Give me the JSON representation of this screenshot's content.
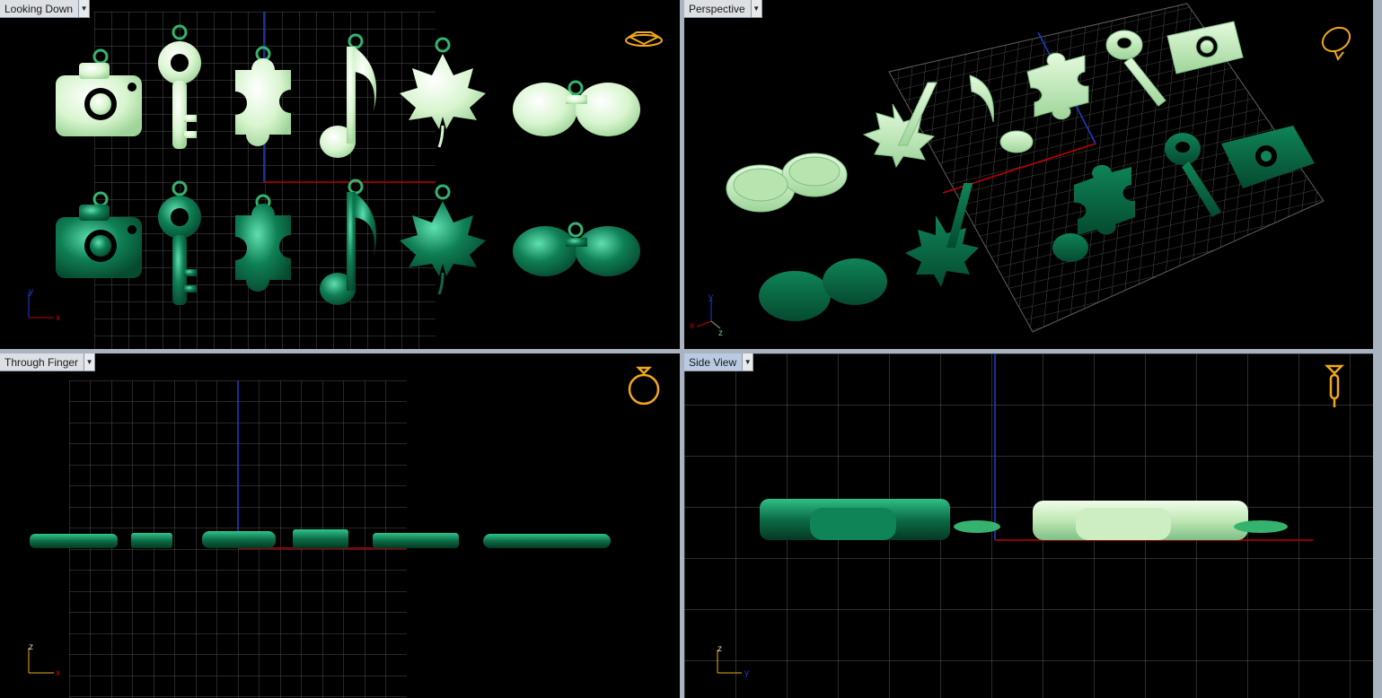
{
  "viewports": {
    "top_left": {
      "title": "Looking Down",
      "icon": "diamond-view-icon"
    },
    "top_right": {
      "title": "Perspective",
      "icon": "ring-perspective-icon"
    },
    "bottom_left": {
      "title": "Through Finger",
      "icon": "ring-front-icon"
    },
    "bottom_right": {
      "title": "Side View",
      "icon": "ring-side-icon"
    }
  },
  "axes": {
    "top_left": [
      "y",
      "x"
    ],
    "top_right": [
      "y",
      "x",
      "z"
    ],
    "bottom_left": [
      "z",
      "x"
    ],
    "bottom_right": [
      "z",
      "y"
    ]
  },
  "colors": {
    "light_green": "#d8f5cf",
    "dark_green": "#0b6b47",
    "jump_ring": "#35b36e",
    "grid": "#5a5a5a",
    "axis_red": "#c00000",
    "axis_blue": "#1c3fd0",
    "widget_gold": "#f0a81a"
  },
  "shapes": [
    "camera",
    "key",
    "puzzle-piece",
    "music-note",
    "maple-leaf",
    "glasses"
  ]
}
